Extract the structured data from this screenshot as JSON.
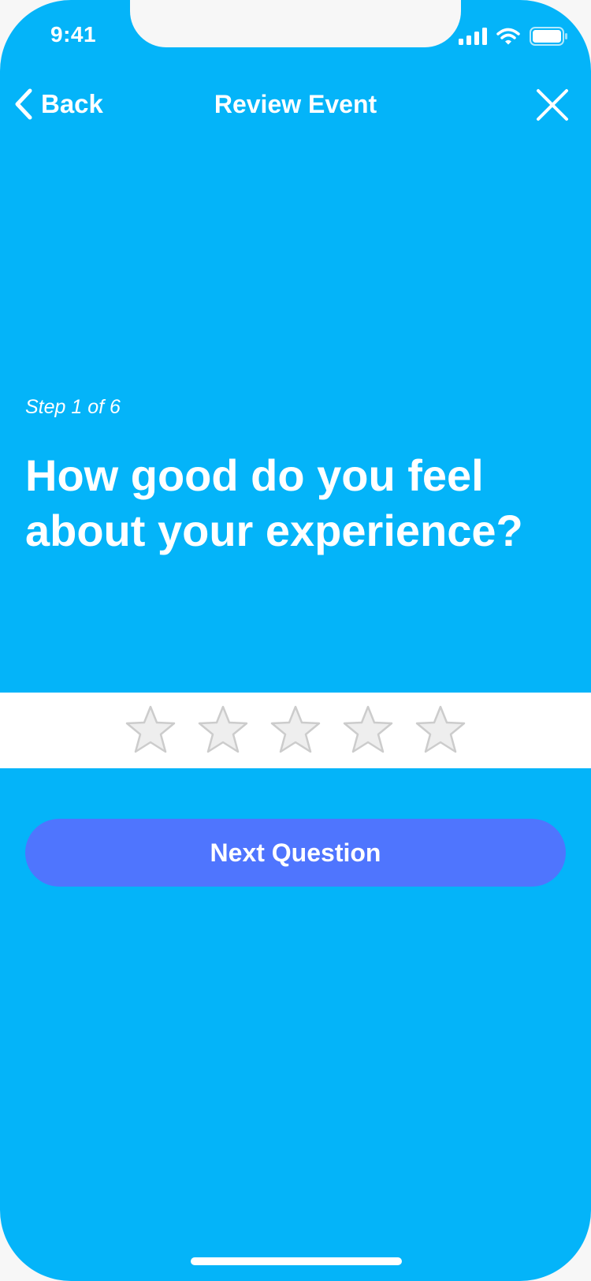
{
  "status_bar": {
    "time": "9:41",
    "icons": [
      "signal-icon",
      "wifi-icon",
      "battery-icon"
    ]
  },
  "nav": {
    "back_label": "Back",
    "title": "Review Event",
    "back_icon": "chevron-left-icon",
    "close_icon": "close-icon"
  },
  "content": {
    "step_label": "Step 1 of 6",
    "question": "How good do you feel about your experience?"
  },
  "rating": {
    "max": 5,
    "value": 0,
    "star_icon": "star-outline-icon"
  },
  "actions": {
    "next_label": "Next Question"
  },
  "colors": {
    "background": "#04b4f9",
    "primary_button": "#4f75fe",
    "star_fill": "#eeeeee",
    "star_stroke": "#cccccc",
    "text": "#ffffff"
  }
}
